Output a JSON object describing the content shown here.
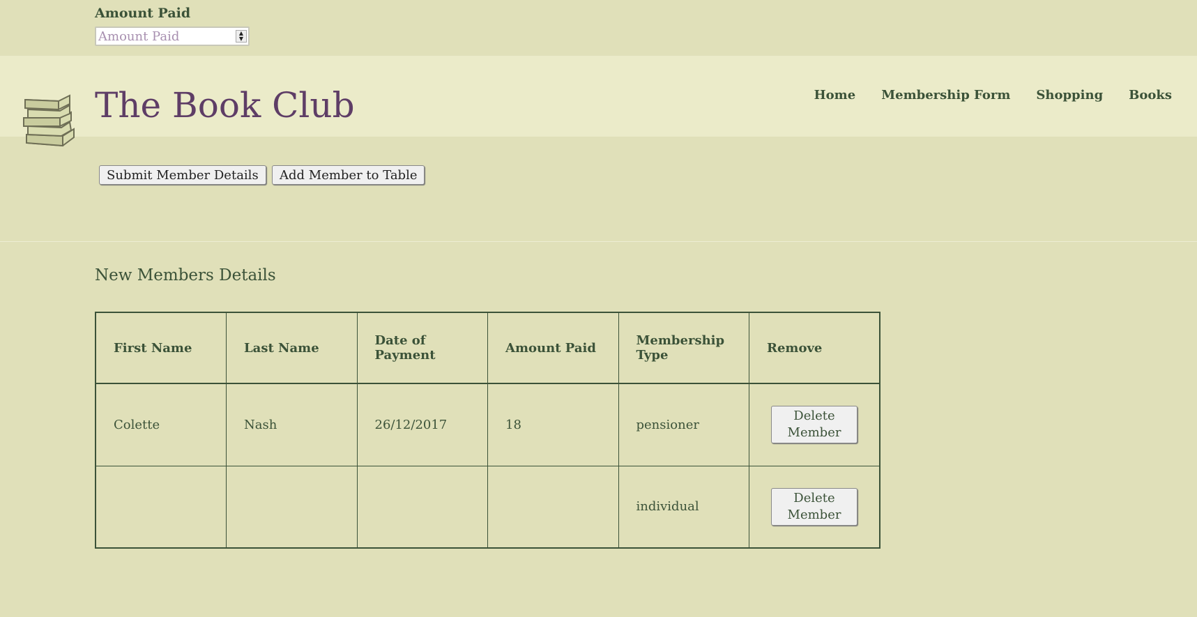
{
  "amount_field": {
    "label": "Amount Paid",
    "placeholder": "Amount Paid",
    "value": ""
  },
  "header": {
    "logo_icon": "books-stack-icon",
    "title": "The Book Club",
    "nav": [
      "Home",
      "Membership Form",
      "Shopping",
      "Books"
    ]
  },
  "actions": {
    "submit_label": "Submit Member Details",
    "add_label": "Add Member to Table"
  },
  "members_section": {
    "title": "New Members Details",
    "columns": [
      "First Name",
      "Last Name",
      "Date of Payment",
      "Amount Paid",
      "Membership Type",
      "Remove"
    ],
    "rows": [
      {
        "first_name": "Colette",
        "last_name": "Nash",
        "date": "26/12/2017",
        "amount": "18",
        "type": "pensioner",
        "remove_label": "Delete Member"
      },
      {
        "first_name": "",
        "last_name": "",
        "date": "",
        "amount": "",
        "type": "individual",
        "remove_label": "Delete Member"
      }
    ]
  },
  "colors": {
    "background": "#e0e0b9",
    "header_band": "#ebebc9",
    "text_green": "#3b5238",
    "title_purple": "#5e3d66"
  }
}
